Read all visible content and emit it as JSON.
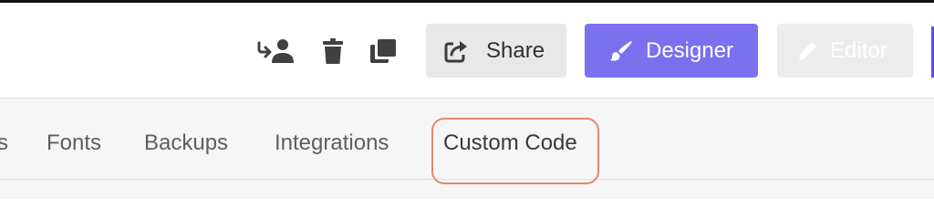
{
  "toolbar": {
    "icons": {
      "assign": "person-arrow-icon",
      "delete": "trash-icon",
      "duplicate": "copy-icon"
    },
    "share": {
      "label": "Share",
      "icon": "share-icon"
    },
    "designer": {
      "label": "Designer",
      "icon": "brush-icon",
      "color": "#7b70ee"
    },
    "editor": {
      "label": "Editor",
      "icon": "pencil-icon",
      "disabled": true
    }
  },
  "tabs": [
    {
      "label": "s"
    },
    {
      "label": "Fonts"
    },
    {
      "label": "Backups"
    },
    {
      "label": "Integrations"
    },
    {
      "label": "Custom Code",
      "highlighted": true
    }
  ],
  "colors": {
    "accent": "#7b70ee",
    "highlight_outline": "#e8876a",
    "tab_bar_bg": "#f6f6f6"
  }
}
